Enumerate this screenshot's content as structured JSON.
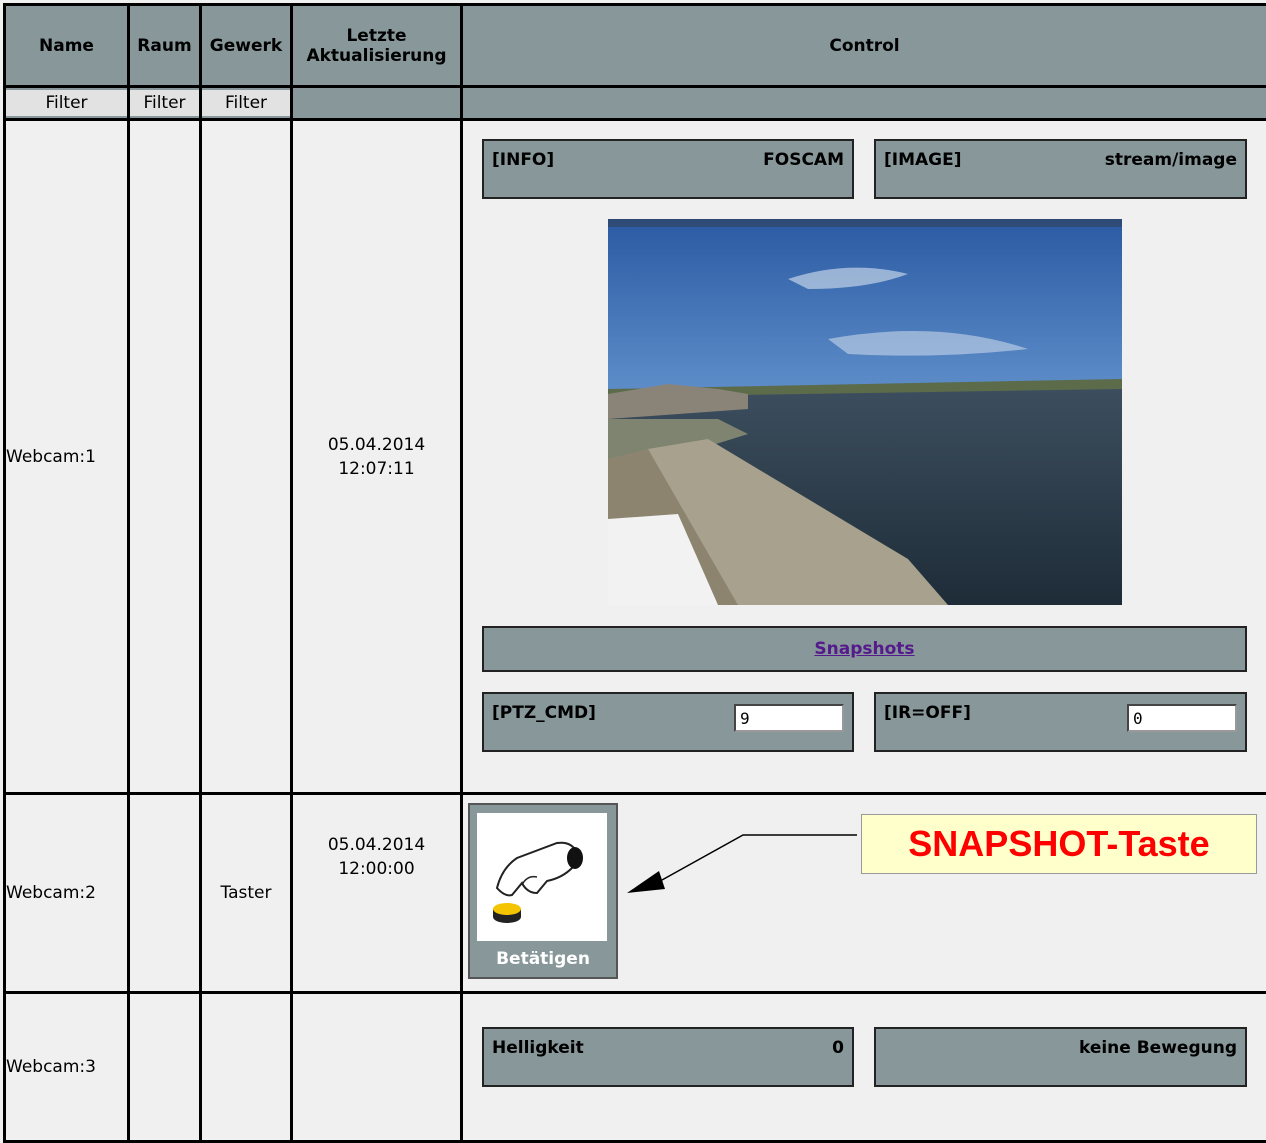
{
  "headers": {
    "name": "Name",
    "raum": "Raum",
    "gewerk": "Gewerk",
    "last_update_line1": "Letzte",
    "last_update_line2": "Aktualisierung",
    "control": "Control"
  },
  "filters": {
    "name": "Filter",
    "raum": "Filter",
    "gewerk": "Filter"
  },
  "rows": [
    {
      "name": "Webcam:1",
      "raum": "",
      "gewerk": "",
      "date": "05.04.2014",
      "time": "12:07:11",
      "info_label": "[INFO]",
      "info_value": "FOSCAM",
      "image_label": "[IMAGE]",
      "image_value": "stream/image",
      "snapshots_link": "Snapshots",
      "ptz_label": "[PTZ_CMD]",
      "ptz_value": "9",
      "ir_label": "[IR=OFF]",
      "ir_value": "0"
    },
    {
      "name": "Webcam:2",
      "raum": "",
      "gewerk": "Taster",
      "date": "05.04.2014",
      "time": "12:00:00",
      "button_label": "Betätigen"
    },
    {
      "name": "Webcam:3",
      "raum": "",
      "gewerk": "",
      "date": "",
      "time": "",
      "brightness_label": "Helligkeit",
      "brightness_value": "0",
      "motion_value": "keine Bewegung"
    }
  ],
  "annotation": "SNAPSHOT-Taste",
  "colors": {
    "header_bg": "#87979a",
    "body_bg": "#f0f0f0",
    "annotation_text": "#ff0000",
    "annotation_bg": "#ffffcc"
  }
}
